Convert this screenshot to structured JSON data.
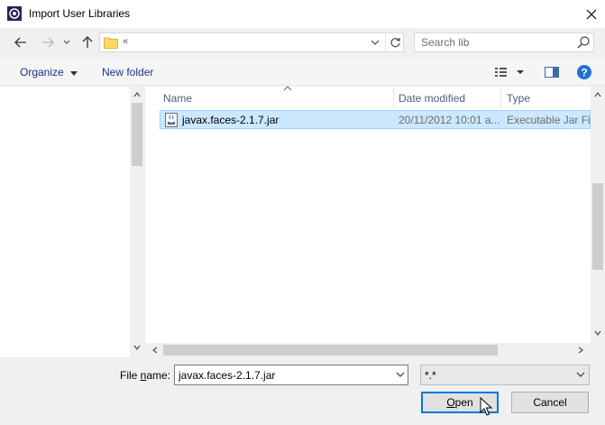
{
  "window": {
    "title": "Import User Libraries"
  },
  "address": {
    "path_text": "«"
  },
  "search": {
    "placeholder": "Search lib"
  },
  "toolbar": {
    "organize_label": "Organize",
    "new_folder_label": "New folder"
  },
  "columns": {
    "name": "Name",
    "date_modified": "Date modified",
    "type": "Type"
  },
  "files": [
    {
      "name": "javax.faces-2.1.7.jar",
      "date": "20/11/2012 10:01 a...",
      "type": "Executable Jar File"
    }
  ],
  "bottom": {
    "file_name_label_pre": "File ",
    "file_name_label_u": "n",
    "file_name_label_post": "ame:",
    "file_name_value": "javax.faces-2.1.7.jar",
    "filter_value": "*.*",
    "open_label_u": "O",
    "open_label_rest": "pen",
    "cancel_label": "Cancel"
  },
  "colors": {
    "selection": "#cce8ff",
    "selection_border": "#99d1ff",
    "accent": "#0078d7"
  },
  "icons": [
    "app-icon",
    "close-icon",
    "back-arrow-icon",
    "forward-arrow-icon",
    "recent-locations-icon",
    "up-arrow-icon",
    "folder-icon",
    "refresh-icon",
    "search-icon",
    "view-options-icon",
    "preview-pane-icon",
    "help-icon",
    "jar-file-icon",
    "mouse-cursor-icon"
  ]
}
